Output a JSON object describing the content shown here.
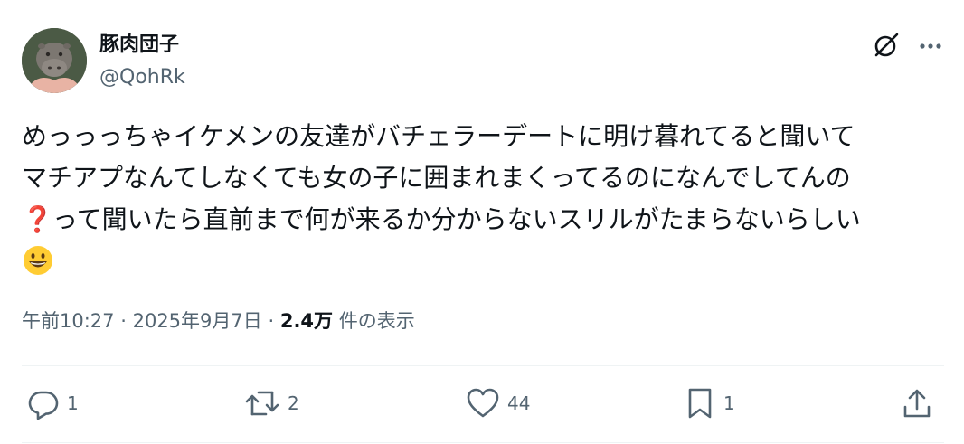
{
  "user": {
    "display_name": "豚肉団子",
    "handle": "@QohRk"
  },
  "tweet": {
    "lines": [
      "めっっっちゃイケメンの友達がバチェラーデートに明け暮れてると聞いて",
      "マチアプなんてしなくても女の子に囲まれまくってるのになんでしてんの",
      "って聞いたら直前まで何が来るか分からないスリルがたまらないらしい"
    ],
    "emoji_question": "❓",
    "emoji_smile": "grinning-face-emoji"
  },
  "meta": {
    "time": "午前10:27",
    "separator": "·",
    "date": "2025年9月7日",
    "views_count": "2.4万",
    "views_label": "件の表示"
  },
  "actions": {
    "reply_count": "1",
    "retweet_count": "2",
    "like_count": "44",
    "bookmark_count": "1"
  },
  "icons": {
    "grok": "grok-icon",
    "more": "more-icon",
    "reply": "reply-icon",
    "retweet": "retweet-icon",
    "like": "heart-icon",
    "bookmark": "bookmark-icon",
    "share": "share-icon"
  },
  "colors": {
    "text_primary": "#0f1419",
    "text_secondary": "#536471",
    "divider": "#eff3f4",
    "emoji_question": "#d8202a"
  }
}
